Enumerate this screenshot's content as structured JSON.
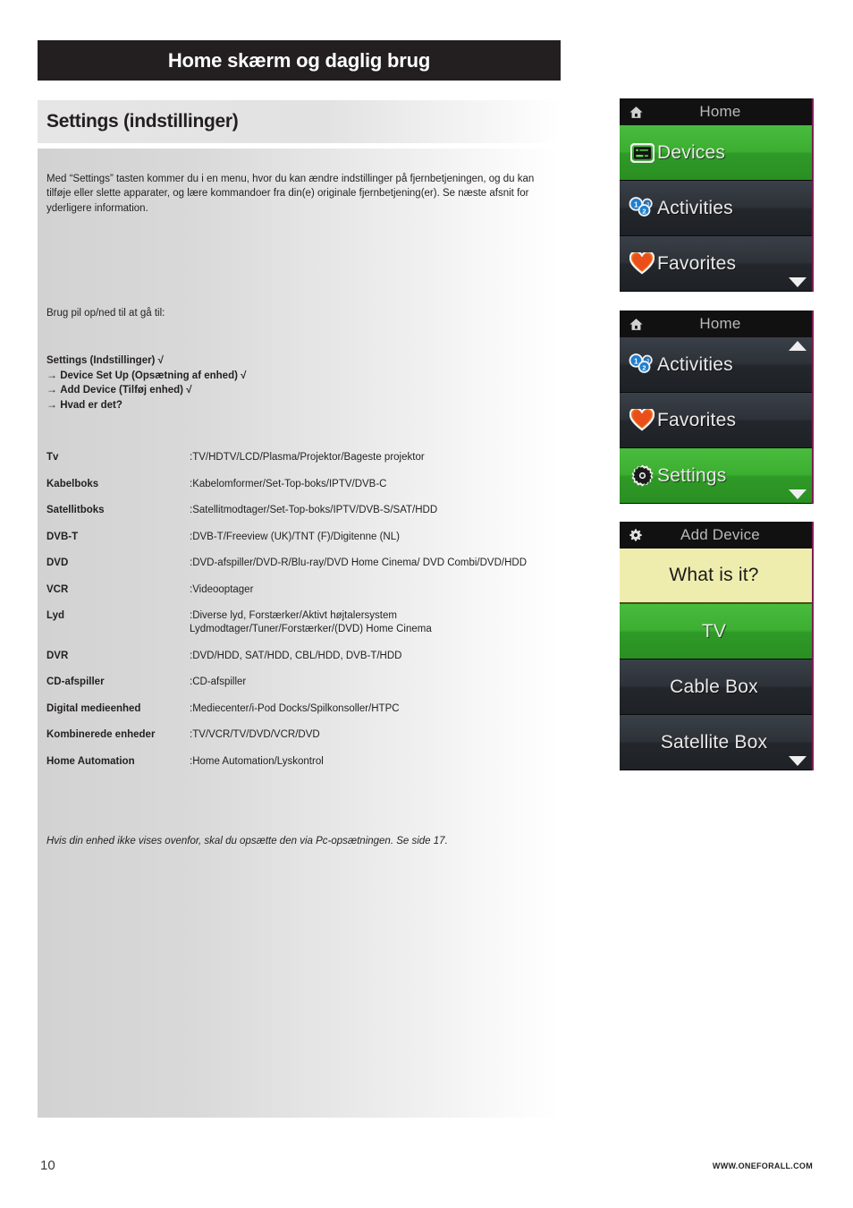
{
  "page_header": {
    "title": "Home skærm og daglig brug"
  },
  "section": {
    "title": "Settings (indstillinger)"
  },
  "body": {
    "intro": "Med “Settings” tasten kommer du i en menu, hvor du kan ændre indstillinger på fjernbetjeningen, og du kan tilføje eller slette apparater, og lære kommandoer fra din(e) originale fjernbetjening(er). Se næste afsnit for yderligere information.",
    "nav_lead": "Brug pil op/ned til at gå til:",
    "nav_steps": [
      {
        "arrow": "",
        "text": "Settings (Indstillinger) √"
      },
      {
        "arrow": "→",
        "text": "Device Set Up (Opsætning af enhed) √"
      },
      {
        "arrow": "→",
        "text": "Add Device (Tilføj enhed) √"
      },
      {
        "arrow": "→",
        "text": "Hvad er det?"
      }
    ],
    "footnote": "Hvis din enhed ikke vises ovenfor, skal du opsætte den via Pc-opsætningen. Se side 17."
  },
  "device_table": {
    "rows": [
      {
        "name": "Tv",
        "desc": ":TV/HDTV/LCD/Plasma/Projektor/Bageste projektor"
      },
      {
        "name": "Kabelboks",
        "desc": ":Kabelomformer/Set-Top-boks/IPTV/DVB-C"
      },
      {
        "name": "Satellitboks",
        "desc": ":Satellitmodtager/Set-Top-boks/IPTV/DVB-S/SAT/HDD"
      },
      {
        "name": "DVB-T",
        "desc": ":DVB-T/Freeview (UK)/TNT (F)/Digitenne (NL)"
      },
      {
        "name": "DVD",
        "desc": ":DVD-afspiller/DVD-R/Blu-ray/DVD Home Cinema/ DVD Combi/DVD/HDD"
      },
      {
        "name": "VCR",
        "desc": ":Videooptager"
      },
      {
        "name": "Lyd",
        "desc": ":Diverse lyd, Forstærker/Aktivt højtalersystem\n Lydmodtager/Tuner/Forstærker/(DVD) Home Cinema"
      },
      {
        "name": "DVR",
        "desc": ":DVD/HDD, SAT/HDD, CBL/HDD, DVB-T/HDD"
      },
      {
        "name": "CD-afspiller",
        "desc": ":CD-afspiller"
      },
      {
        "name": "Digital medieenhed",
        "desc": ":Mediecenter/i-Pod Docks/Spilkonsoller/HTPC"
      },
      {
        "name": "Kombinerede enheder",
        "desc": ":TV/VCR/TV/DVD/VCR/DVD"
      },
      {
        "name": "Home Automation",
        "desc": ":Home Automation/Lyskontrol"
      }
    ]
  },
  "screens": [
    {
      "id": "home-devices",
      "titlebar": {
        "icon": "home-icon",
        "label": "Home"
      },
      "rows": [
        {
          "label": "Devices",
          "icon": "devices-icon",
          "state": "selected"
        },
        {
          "label": "Activities",
          "icon": "activities-icon",
          "state": "normal"
        },
        {
          "label": "Favorites",
          "icon": "favorites-icon",
          "state": "normal"
        }
      ],
      "scroll": {
        "down": true,
        "up": false
      }
    },
    {
      "id": "home-settings",
      "titlebar": {
        "icon": "home-icon",
        "label": "Home"
      },
      "rows": [
        {
          "label": "Activities",
          "icon": "activities-icon",
          "state": "normal"
        },
        {
          "label": "Favorites",
          "icon": "favorites-icon",
          "state": "normal"
        },
        {
          "label": "Settings",
          "icon": "settings-icon",
          "state": "selected"
        }
      ],
      "scroll": {
        "down": true,
        "up": true
      }
    },
    {
      "id": "add-device",
      "titlebar": {
        "icon": "gear-icon",
        "label": "Add Device"
      },
      "rows": [
        {
          "label": "What is it?",
          "icon": "none",
          "state": "prompt"
        },
        {
          "label": "TV",
          "icon": "none",
          "state": "selected"
        },
        {
          "label": "Cable Box",
          "icon": "none",
          "state": "normal"
        },
        {
          "label": "Satellite Box",
          "icon": "none",
          "state": "normal"
        }
      ],
      "scroll": {
        "down": true,
        "up": false
      }
    }
  ],
  "footer": {
    "page_number": "10",
    "url": "WWW.ONEFORALL.COM"
  },
  "colors": {
    "header_bar": "#231f20",
    "accent_green": "#3cae31",
    "prompt_yellow": "#eeedae",
    "screen_dark": "#2d3238",
    "frame_edge": "#7b1f56"
  }
}
